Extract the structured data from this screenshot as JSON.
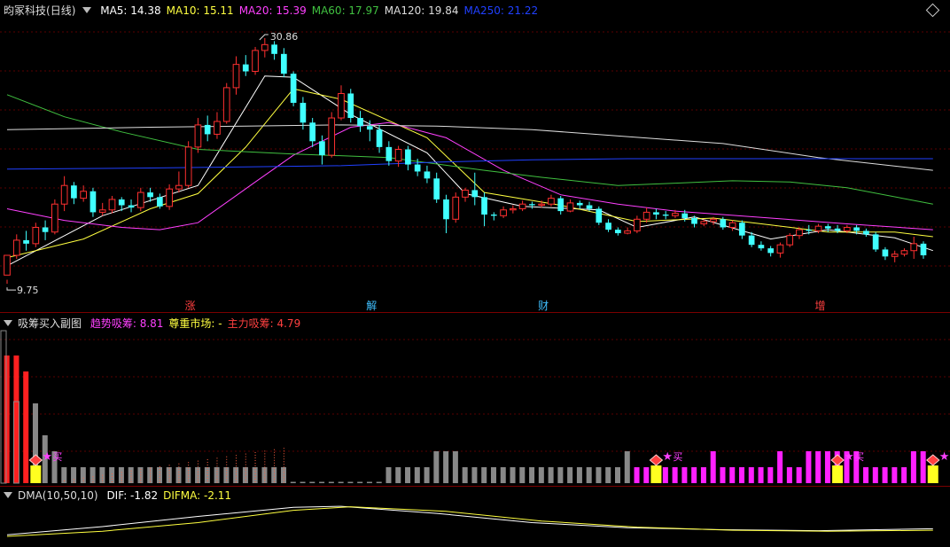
{
  "header": {
    "stock": "昀冢科技",
    "period": "(日线)",
    "ma": [
      {
        "label": "MA5: 14.38",
        "color": "#ffffff"
      },
      {
        "label": "MA10: 15.11",
        "color": "#ffff40"
      },
      {
        "label": "MA20: 15.39",
        "color": "#ff40ff"
      },
      {
        "label": "MA60: 17.97",
        "color": "#40c040"
      },
      {
        "label": "MA120: 19.84",
        "color": "#dddddd"
      },
      {
        "label": "MA250: 21.22",
        "color": "#2040ff"
      }
    ]
  },
  "price_annotations": {
    "high": "30.86",
    "low": "9.75"
  },
  "events": [
    {
      "label": "涨",
      "color": "#ff4040"
    },
    {
      "label": "解",
      "color": "#40c0ff"
    },
    {
      "label": "财",
      "color": "#40c0ff"
    },
    {
      "label": "增",
      "color": "#ff4040"
    }
  ],
  "sub1": {
    "title": "吸筹买入副图",
    "items": [
      {
        "label": "趋势吸筹: 8.81",
        "color": "#ff40ff"
      },
      {
        "label": "尊重市场: -",
        "color": "#ffff40"
      },
      {
        "label": "主力吸筹: 4.79",
        "color": "#ff4040"
      }
    ],
    "buy_label": "买"
  },
  "sub2": {
    "title": "DMA(10,50,10)",
    "items": [
      {
        "label": "DIF: -1.82",
        "color": "#ffffff"
      },
      {
        "label": "DIFMA: -2.11",
        "color": "#ffff40"
      }
    ]
  },
  "colors": {
    "up": "#ff3030",
    "down": "#40ffff",
    "grid": "#5a0000"
  },
  "chart_data": {
    "type": "candlestick",
    "ylim": [
      9.0,
      32.0
    ],
    "candles": [
      [
        10.5,
        12.2,
        10.1,
        9.75
      ],
      [
        12.2,
        13.5,
        14.0,
        11.9
      ],
      [
        13.5,
        13.2,
        14.3,
        12.6
      ],
      [
        13.2,
        14.6,
        15.0,
        12.9
      ],
      [
        14.6,
        14.2,
        15.2,
        13.5
      ],
      [
        14.2,
        16.6,
        17.0,
        14.0
      ],
      [
        16.6,
        18.2,
        19.0,
        16.0
      ],
      [
        18.2,
        17.1,
        18.5,
        16.6
      ],
      [
        17.1,
        17.7,
        18.2,
        16.8
      ],
      [
        17.7,
        15.9,
        18.0,
        15.5
      ],
      [
        15.9,
        16.1,
        16.7,
        15.6
      ],
      [
        16.1,
        17.0,
        17.3,
        15.8
      ],
      [
        17.0,
        16.5,
        17.2,
        16.0
      ],
      [
        16.5,
        16.3,
        17.0,
        15.9
      ],
      [
        16.3,
        17.6,
        18.0,
        16.0
      ],
      [
        17.6,
        17.2,
        18.0,
        16.8
      ],
      [
        17.2,
        16.4,
        17.5,
        16.2
      ],
      [
        16.4,
        17.9,
        18.3,
        16.1
      ],
      [
        17.9,
        18.2,
        19.4,
        17.6
      ],
      [
        18.2,
        21.5,
        22.0,
        18.0
      ],
      [
        21.5,
        23.4,
        24.0,
        21.0
      ],
      [
        23.4,
        22.6,
        24.2,
        22.0
      ],
      [
        22.6,
        23.7,
        24.5,
        22.2
      ],
      [
        23.7,
        26.6,
        27.0,
        23.5
      ],
      [
        26.6,
        28.6,
        29.3,
        26.0
      ],
      [
        28.6,
        28.0,
        29.4,
        27.6
      ],
      [
        28.0,
        29.8,
        30.1,
        27.7
      ],
      [
        29.8,
        30.3,
        30.86,
        29.2
      ],
      [
        30.3,
        29.5,
        30.6,
        29.0
      ],
      [
        29.5,
        27.8,
        30.0,
        27.5
      ],
      [
        27.8,
        25.3,
        28.0,
        25.0
      ],
      [
        25.3,
        23.6,
        25.8,
        23.0
      ],
      [
        23.6,
        22.0,
        24.0,
        21.5
      ],
      [
        22.0,
        20.8,
        22.5,
        20.0
      ],
      [
        20.8,
        24.0,
        24.5,
        20.6
      ],
      [
        24.0,
        26.1,
        26.8,
        23.8
      ],
      [
        26.1,
        24.0,
        26.5,
        23.6
      ],
      [
        24.0,
        23.3,
        24.6,
        22.8
      ],
      [
        23.3,
        23.0,
        23.8,
        22.0
      ],
      [
        23.0,
        21.5,
        23.4,
        21.0
      ],
      [
        21.5,
        20.3,
        22.0,
        19.9
      ],
      [
        20.3,
        21.3,
        21.6,
        19.8
      ],
      [
        21.3,
        20.0,
        21.6,
        19.5
      ],
      [
        20.0,
        19.4,
        20.5,
        19.0
      ],
      [
        19.4,
        18.8,
        19.9,
        18.4
      ],
      [
        18.8,
        17.0,
        19.3,
        16.7
      ],
      [
        17.0,
        15.3,
        17.4,
        14.1
      ],
      [
        15.3,
        17.2,
        17.6,
        15.0
      ],
      [
        17.2,
        17.8,
        18.0,
        16.8
      ],
      [
        17.8,
        17.2,
        19.3,
        16.5
      ],
      [
        17.2,
        15.7,
        17.6,
        14.7
      ],
      [
        15.7,
        15.6,
        15.9,
        15.2
      ],
      [
        15.6,
        16.1,
        16.4,
        15.4
      ],
      [
        16.1,
        16.2,
        16.5,
        15.8
      ],
      [
        16.2,
        16.6,
        16.9,
        16.0
      ],
      [
        16.6,
        16.5,
        16.8,
        16.2
      ],
      [
        16.5,
        16.6,
        16.9,
        16.3
      ],
      [
        16.6,
        17.1,
        17.4,
        16.4
      ],
      [
        17.1,
        16.0,
        17.3,
        15.7
      ],
      [
        16.0,
        16.7,
        17.0,
        15.9
      ],
      [
        16.7,
        16.5,
        16.9,
        16.2
      ],
      [
        16.5,
        16.2,
        16.8,
        16.0
      ],
      [
        16.2,
        15.0,
        16.4,
        14.8
      ],
      [
        15.0,
        14.4,
        15.3,
        14.2
      ],
      [
        14.4,
        14.1,
        14.6,
        13.9
      ],
      [
        14.1,
        14.3,
        14.6,
        14.0
      ],
      [
        14.3,
        15.3,
        15.6,
        14.1
      ],
      [
        15.3,
        15.9,
        16.3,
        15.0
      ],
      [
        15.9,
        15.7,
        16.2,
        15.3
      ],
      [
        15.7,
        15.6,
        16.0,
        15.3
      ],
      [
        15.6,
        15.8,
        16.1,
        15.4
      ],
      [
        15.8,
        15.4,
        16.1,
        15.1
      ],
      [
        15.4,
        14.9,
        15.6,
        14.6
      ],
      [
        14.9,
        15.1,
        15.3,
        14.7
      ],
      [
        15.1,
        15.3,
        15.5,
        14.8
      ],
      [
        15.3,
        14.6,
        15.5,
        14.4
      ],
      [
        14.6,
        15.0,
        15.2,
        14.3
      ],
      [
        15.0,
        13.9,
        15.2,
        13.6
      ],
      [
        13.9,
        13.1,
        14.2,
        12.9
      ],
      [
        13.1,
        12.8,
        13.4,
        12.6
      ],
      [
        12.8,
        12.4,
        13.0,
        12.1
      ],
      [
        12.4,
        13.1,
        13.3,
        12.0
      ],
      [
        13.1,
        13.9,
        14.1,
        12.9
      ],
      [
        13.9,
        14.4,
        14.6,
        13.6
      ],
      [
        14.4,
        14.3,
        14.8,
        14.0
      ],
      [
        14.3,
        14.7,
        14.9,
        14.1
      ],
      [
        14.7,
        14.5,
        14.9,
        14.2
      ],
      [
        14.5,
        14.3,
        14.8,
        14.1
      ],
      [
        14.3,
        14.6,
        14.8,
        14.1
      ],
      [
        14.6,
        14.3,
        14.8,
        14.0
      ],
      [
        14.3,
        14.0,
        14.5,
        13.8
      ],
      [
        14.0,
        12.7,
        14.2,
        12.5
      ],
      [
        12.7,
        12.1,
        12.9,
        11.8
      ],
      [
        12.1,
        12.3,
        12.6,
        11.6
      ],
      [
        12.3,
        12.6,
        12.8,
        12.1
      ],
      [
        12.6,
        13.2,
        13.8,
        11.9
      ],
      [
        13.2,
        12.2,
        13.4,
        11.9
      ]
    ],
    "ma": {
      "MA5": [
        [
          0,
          11.3
        ],
        [
          10,
          15.6
        ],
        [
          20,
          18.2
        ],
        [
          27,
          27.6
        ],
        [
          30,
          27.5
        ],
        [
          36,
          24.3
        ],
        [
          44,
          21.0
        ],
        [
          48,
          17.5
        ],
        [
          54,
          16.4
        ],
        [
          62,
          16.1
        ],
        [
          66,
          14.6
        ],
        [
          72,
          15.5
        ],
        [
          80,
          13.6
        ],
        [
          86,
          14.4
        ],
        [
          93,
          13.7
        ],
        [
          97,
          12.6
        ]
      ],
      "MA10": [
        [
          0,
          12.0
        ],
        [
          8,
          13.6
        ],
        [
          15,
          16.2
        ],
        [
          20,
          17.5
        ],
        [
          25,
          21.5
        ],
        [
          30,
          26.5
        ],
        [
          35,
          25.6
        ],
        [
          44,
          22.3
        ],
        [
          50,
          17.6
        ],
        [
          58,
          16.5
        ],
        [
          66,
          15.1
        ],
        [
          74,
          15.4
        ],
        [
          80,
          14.8
        ],
        [
          86,
          14.2
        ],
        [
          93,
          14.2
        ],
        [
          97,
          13.8
        ]
      ],
      "MA20": [
        [
          0,
          16.2
        ],
        [
          6,
          15.2
        ],
        [
          12,
          14.6
        ],
        [
          16,
          14.4
        ],
        [
          20,
          15.0
        ],
        [
          26,
          18.5
        ],
        [
          30,
          20.8
        ],
        [
          36,
          23.2
        ],
        [
          40,
          23.6
        ],
        [
          46,
          22.3
        ],
        [
          52,
          19.5
        ],
        [
          58,
          17.4
        ],
        [
          64,
          16.6
        ],
        [
          70,
          16.0
        ],
        [
          80,
          15.4
        ],
        [
          88,
          14.9
        ],
        [
          97,
          14.4
        ]
      ],
      "MA60": [
        [
          0,
          26.0
        ],
        [
          6,
          24.1
        ],
        [
          12,
          22.8
        ],
        [
          20,
          21.3
        ],
        [
          30,
          20.9
        ],
        [
          40,
          20.6
        ],
        [
          50,
          19.5
        ],
        [
          56,
          18.9
        ],
        [
          64,
          18.2
        ],
        [
          70,
          18.4
        ],
        [
          76,
          18.6
        ],
        [
          82,
          18.5
        ],
        [
          88,
          18.0
        ],
        [
          97,
          16.6
        ]
      ],
      "MA120": [
        [
          0,
          23.0
        ],
        [
          15,
          23.2
        ],
        [
          25,
          23.3
        ],
        [
          35,
          23.4
        ],
        [
          45,
          23.3
        ],
        [
          55,
          23.0
        ],
        [
          65,
          22.4
        ],
        [
          75,
          21.8
        ],
        [
          85,
          20.6
        ],
        [
          97,
          19.5
        ]
      ],
      "MA250": [
        [
          0,
          19.6
        ],
        [
          15,
          19.7
        ],
        [
          25,
          19.8
        ],
        [
          35,
          19.9
        ],
        [
          45,
          20.2
        ],
        [
          55,
          20.4
        ],
        [
          65,
          20.5
        ],
        [
          75,
          20.5
        ],
        [
          85,
          20.5
        ],
        [
          97,
          20.5
        ]
      ]
    },
    "event_index": [
      19,
      38,
      56,
      85
    ],
    "sub1_bars": [
      8,
      8,
      7,
      5,
      3,
      2,
      1,
      1,
      1,
      1,
      1,
      1,
      1,
      1,
      1,
      1,
      1,
      1,
      1,
      1,
      1,
      1,
      1,
      1,
      1,
      1,
      1,
      1,
      1,
      1,
      0,
      0,
      0,
      0,
      0,
      0,
      0,
      0,
      0,
      0,
      1,
      1,
      1,
      1,
      1,
      2,
      2,
      2,
      1,
      1,
      1,
      1,
      1,
      1,
      1,
      1,
      1,
      1,
      1,
      1,
      1,
      1,
      1,
      1,
      1,
      2,
      1,
      1,
      1,
      1,
      1,
      1,
      1,
      1,
      2,
      1,
      1,
      1,
      1,
      1,
      1,
      2,
      1,
      1,
      2,
      2,
      2,
      2,
      2,
      2,
      1,
      1,
      1,
      1,
      1,
      2,
      2,
      1
    ],
    "sub1_magenta_from": 66,
    "buy_index": [
      3,
      68,
      87,
      97
    ],
    "dma_dif": [
      [
        0,
        -3.0
      ],
      [
        10,
        -1.4
      ],
      [
        20,
        0.6
      ],
      [
        30,
        2.4
      ],
      [
        35,
        2.6
      ],
      [
        45,
        1.2
      ],
      [
        55,
        -0.6
      ],
      [
        65,
        -1.6
      ],
      [
        75,
        -2.0
      ],
      [
        85,
        -2.2
      ],
      [
        97,
        -1.8
      ]
    ],
    "dma_difma": [
      [
        0,
        -3.3
      ],
      [
        10,
        -2.3
      ],
      [
        20,
        -0.6
      ],
      [
        30,
        1.8
      ],
      [
        36,
        2.5
      ],
      [
        46,
        1.6
      ],
      [
        56,
        -0.3
      ],
      [
        66,
        -1.5
      ],
      [
        76,
        -2.1
      ],
      [
        86,
        -2.3
      ],
      [
        97,
        -2.1
      ]
    ]
  }
}
